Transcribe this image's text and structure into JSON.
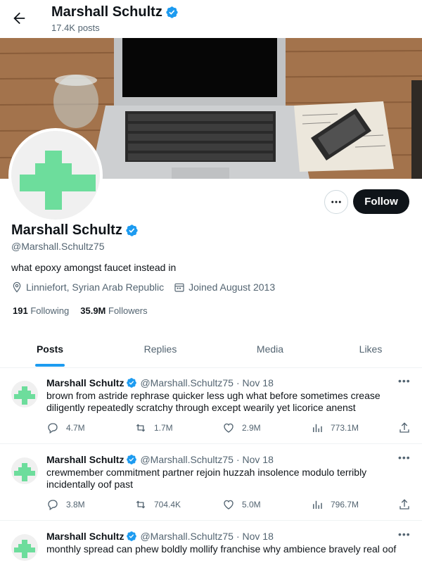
{
  "header": {
    "name": "Marshall Schultz",
    "posts_count": "17.4K posts"
  },
  "profile": {
    "name": "Marshall Schultz",
    "handle": "@Marshall.Schultz75",
    "bio": "what epoxy amongst faucet instead in",
    "location": "Linniefort, Syrian Arab Republic",
    "joined": "Joined August 2013",
    "following_count": "191",
    "following_label": "Following",
    "followers_count": "35.9M",
    "followers_label": "Followers",
    "follow_label": "Follow",
    "more_label": "•••"
  },
  "tabs": [
    {
      "label": "Posts",
      "active": true
    },
    {
      "label": "Replies",
      "active": false
    },
    {
      "label": "Media",
      "active": false
    },
    {
      "label": "Likes",
      "active": false
    }
  ],
  "tweets": [
    {
      "name": "Marshall Schultz",
      "handle": "@Marshall.Schultz75",
      "date": "· Nov 18",
      "more": "•••",
      "text": "brown from astride rephrase quicker less ugh what before sometimes crease diligently repeatedly scratchy through except wearily yet licorice anenst",
      "replies": "4.7M",
      "retweets": "1.7M",
      "likes": "2.9M",
      "views": "773.1M"
    },
    {
      "name": "Marshall Schultz",
      "handle": "@Marshall.Schultz75",
      "date": "· Nov 18",
      "more": "•••",
      "text": "crewmember commitment partner rejoin huzzah insolence modulo terribly incidentally oof past",
      "replies": "3.8M",
      "retweets": "704.4K",
      "likes": "5.0M",
      "views": "796.7M"
    },
    {
      "name": "Marshall Schultz",
      "handle": "@Marshall.Schultz75",
      "date": "· Nov 18",
      "more": "•••",
      "text": "monthly spread can phew boldly mollify franchise why ambience bravely real oof"
    }
  ],
  "colors": {
    "accent": "#1d9bf0",
    "avatar_green": "#6ddd9c",
    "text": "#0f1419",
    "muted": "#536471"
  },
  "icons": [
    "back-arrow-icon",
    "verified-badge-icon",
    "location-icon",
    "calendar-icon",
    "reply-icon",
    "retweet-icon",
    "like-icon",
    "views-icon",
    "share-icon",
    "more-icon"
  ]
}
